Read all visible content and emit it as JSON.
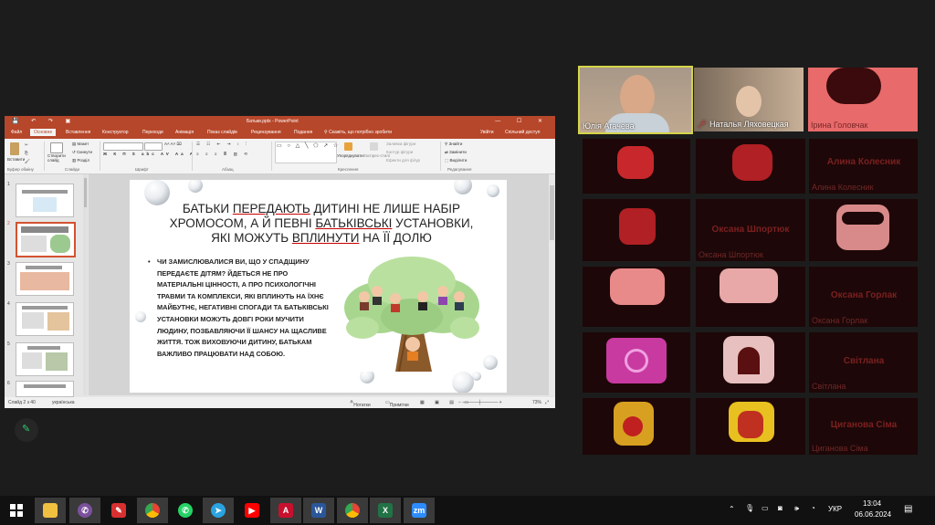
{
  "powerpoint": {
    "title": "Батьки.pptx - PowerPoint",
    "tabs": [
      "Файл",
      "Основне",
      "Вставлення",
      "Конструктор",
      "Переходи",
      "Анімація",
      "Показ слайдів",
      "Рецензування",
      "Подання"
    ],
    "tell_me": "Скажіть, що потрібно зробити",
    "sign_in": "Увійти",
    "share": "Спільний доступ",
    "ribbon_groups": [
      "Буфер обміну",
      "Слайди",
      "Шрифт",
      "Абзац",
      "Креслення",
      "Редагування"
    ],
    "ribbon_items": {
      "paste": "Вставити",
      "new_slide": "Створити слайд",
      "layout": "Макет",
      "reset": "Скинути",
      "section": "Розділ",
      "arrange": "Упорядкувати",
      "quick_styles": "Експрес-стилі",
      "fill": "Заливка фігури",
      "outline": "Контур фігури",
      "effects": "Ефекти для фігур",
      "find": "Знайти",
      "replace": "Замінити",
      "select": "Виділити"
    },
    "thumbnail_numbers": [
      "1",
      "2",
      "3",
      "4",
      "5",
      "6"
    ],
    "selected_thumbnail": 2,
    "status": {
      "slide": "Слайд 2 з 40",
      "language": "українська",
      "notes": "Нотатки",
      "comments": "Примітки",
      "zoom": "73%"
    }
  },
  "slide": {
    "title_line1_pre": "БАТЬКИ ",
    "title_line1_u": "ПЕРЕДАЮТЬ",
    "title_line1_post": " ДИТИНІ НЕ ЛИШЕ НАБІР",
    "title_line2_pre": "ХРОМОСОМ, А Й ПЕВНІ ",
    "title_line2_u": "БАТЬКІВСЬКІ",
    "title_line2_post": " УСТАНОВКИ,",
    "title_line3_pre": "ЯКІ МОЖУТЬ ",
    "title_line3_u": "ВПЛИНУТИ",
    "title_line3_post": " НА ЇЇ ДОЛЮ",
    "bullet": "ЧИ ЗАМИСЛЮВАЛИСЯ ВИ, ЩО У СПАДЩИНУ ПЕРЕДАЄТЕ ДІТЯМ? ЙДЕТЬСЯ НЕ ПРО МАТЕРІАЛЬНІ ЦІННОСТІ, А ПРО ПСИХОЛОГІЧНІ ТРАВМИ ТА КОМПЛЕКСИ, ЯКІ ВПЛИНУТЬ НА ЇХНЄ МАЙБУТНЄ, НЕГАТИВНІ СПОГАДИ ТА БАТЬКІВСЬКІ УСТАНОВКИ МОЖУТЬ ДОВГІ РОКИ МУЧИТИ ЛЮДИНУ, ПОЗБАВЛЯЮЧИ ЇЇ ШАНСУ НА ЩАСЛИВЕ ЖИТТЯ. ТОЖ ВИХОВУЮЧИ ДИТИНУ, БАТЬКАМ ВАЖЛИВО ПРАЦЮВАТИ НАД СОБОЮ."
  },
  "participants": [
    {
      "name": "Юлія Агачева",
      "video": true
    },
    {
      "name": "Наталья Ляховецкая",
      "video": true
    },
    {
      "name": "Ірина Головчак",
      "video": false
    },
    {
      "name": "Алина Колесник",
      "video": false
    },
    {
      "name": "Оксана Шпортюк",
      "video": false
    },
    {
      "name": "Оксана Горлак",
      "video": false
    },
    {
      "name": "Світлана",
      "video": false
    },
    {
      "name": "Циганова Сіма",
      "video": false
    }
  ],
  "taskbar": {
    "apps": [
      "file-explorer",
      "viber",
      "pdf-reader",
      "chrome",
      "whatsapp",
      "telegram",
      "youtube",
      "acrobat",
      "word",
      "chrome",
      "excel",
      "zoom"
    ],
    "language": "УКР",
    "time": "13:04",
    "date": "06.06.2024"
  }
}
